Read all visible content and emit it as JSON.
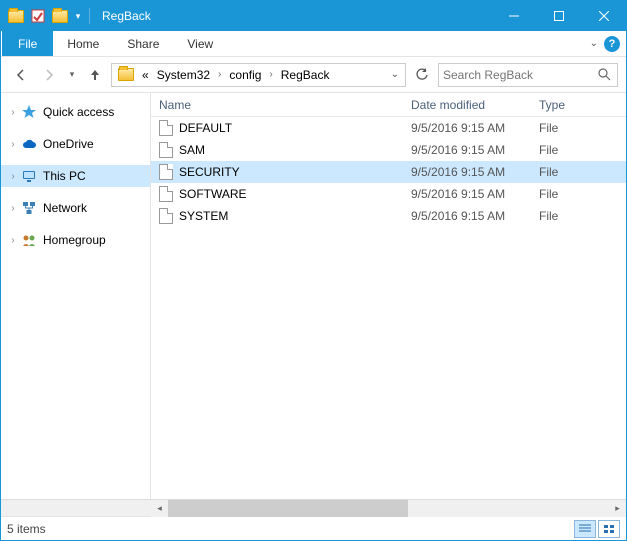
{
  "window": {
    "title": "RegBack"
  },
  "ribbon": {
    "file": "File",
    "tabs": [
      "Home",
      "Share",
      "View"
    ]
  },
  "breadcrumb": {
    "prefix": "«",
    "segments": [
      "System32",
      "config",
      "RegBack"
    ]
  },
  "search": {
    "placeholder": "Search RegBack"
  },
  "navpane": {
    "items": [
      {
        "label": "Quick access",
        "icon": "star",
        "color": "#3aa0e0",
        "expandable": true
      },
      {
        "gap": true
      },
      {
        "label": "OneDrive",
        "icon": "cloud",
        "color": "#0a68c3",
        "expandable": true
      },
      {
        "gap": true
      },
      {
        "label": "This PC",
        "icon": "pc",
        "color": "#2a7ab9",
        "expandable": true,
        "selected": true
      },
      {
        "gap": true
      },
      {
        "label": "Network",
        "icon": "network",
        "color": "#3a7fb5",
        "expandable": true
      },
      {
        "gap": true
      },
      {
        "label": "Homegroup",
        "icon": "homegroup",
        "color": "#c77a2e",
        "expandable": true
      }
    ]
  },
  "columns": {
    "name": "Name",
    "date": "Date modified",
    "type": "Type"
  },
  "files": [
    {
      "name": "DEFAULT",
      "date": "9/5/2016 9:15 AM",
      "type": "File",
      "selected": false
    },
    {
      "name": "SAM",
      "date": "9/5/2016 9:15 AM",
      "type": "File",
      "selected": false
    },
    {
      "name": "SECURITY",
      "date": "9/5/2016 9:15 AM",
      "type": "File",
      "selected": true
    },
    {
      "name": "SOFTWARE",
      "date": "9/5/2016 9:15 AM",
      "type": "File",
      "selected": false
    },
    {
      "name": "SYSTEM",
      "date": "9/5/2016 9:15 AM",
      "type": "File",
      "selected": false
    }
  ],
  "status": {
    "text": "5 items"
  }
}
